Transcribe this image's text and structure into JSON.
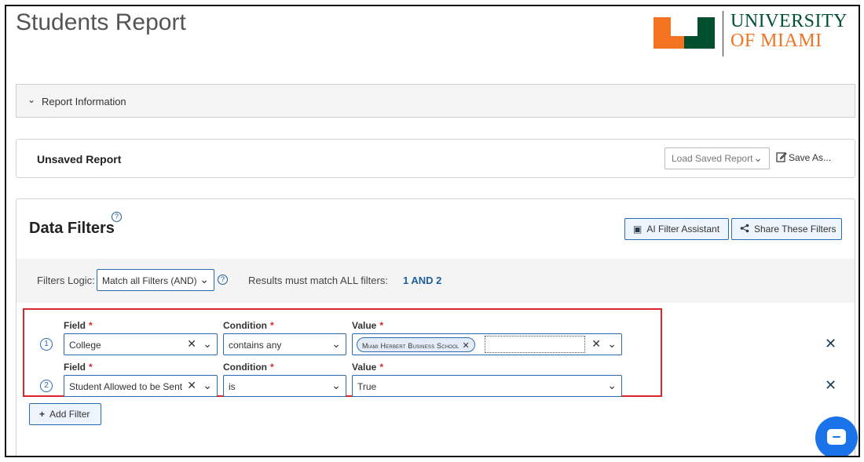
{
  "page": {
    "title": "Students Report"
  },
  "logo": {
    "line1": "UNIVERSITY",
    "line2": "OF MIAMI",
    "colors": {
      "green": "#005030",
      "orange": "#f47321"
    }
  },
  "report_info": {
    "label": "Report Information",
    "icon": "chevron-down-icon"
  },
  "unsaved": {
    "label": "Unsaved Report",
    "load_saved": "Load Saved Report",
    "save_as": "Save As..."
  },
  "filters": {
    "title": "Data Filters",
    "help": "?",
    "ai_assistant": "AI Filter Assistant",
    "share": "Share These Filters",
    "logic_label": "Filters Logic:",
    "logic_value": "Match all Filters (AND)",
    "results_text": "Results must match ALL filters:",
    "logic_expression": "1 AND 2",
    "rows": [
      {
        "number": "1",
        "field_label": "Field",
        "field_value": "College",
        "condition_label": "Condition",
        "condition_value": "contains any",
        "value_label": "Value",
        "value_chip": "Miami Herbert Business School"
      },
      {
        "number": "2",
        "field_label": "Field",
        "field_value": "Student Allowed to be Sent",
        "condition_label": "Condition",
        "condition_value": "is",
        "value_label": "Value",
        "value_value": "True"
      }
    ],
    "required_marker": "*",
    "add_filter": "Add Filter"
  },
  "colors": {
    "accent": "#2a6bb0",
    "link": "#1f5f9c",
    "required": "#d9262c",
    "highlight": "#d9262c",
    "chat": "#1a73e8"
  }
}
